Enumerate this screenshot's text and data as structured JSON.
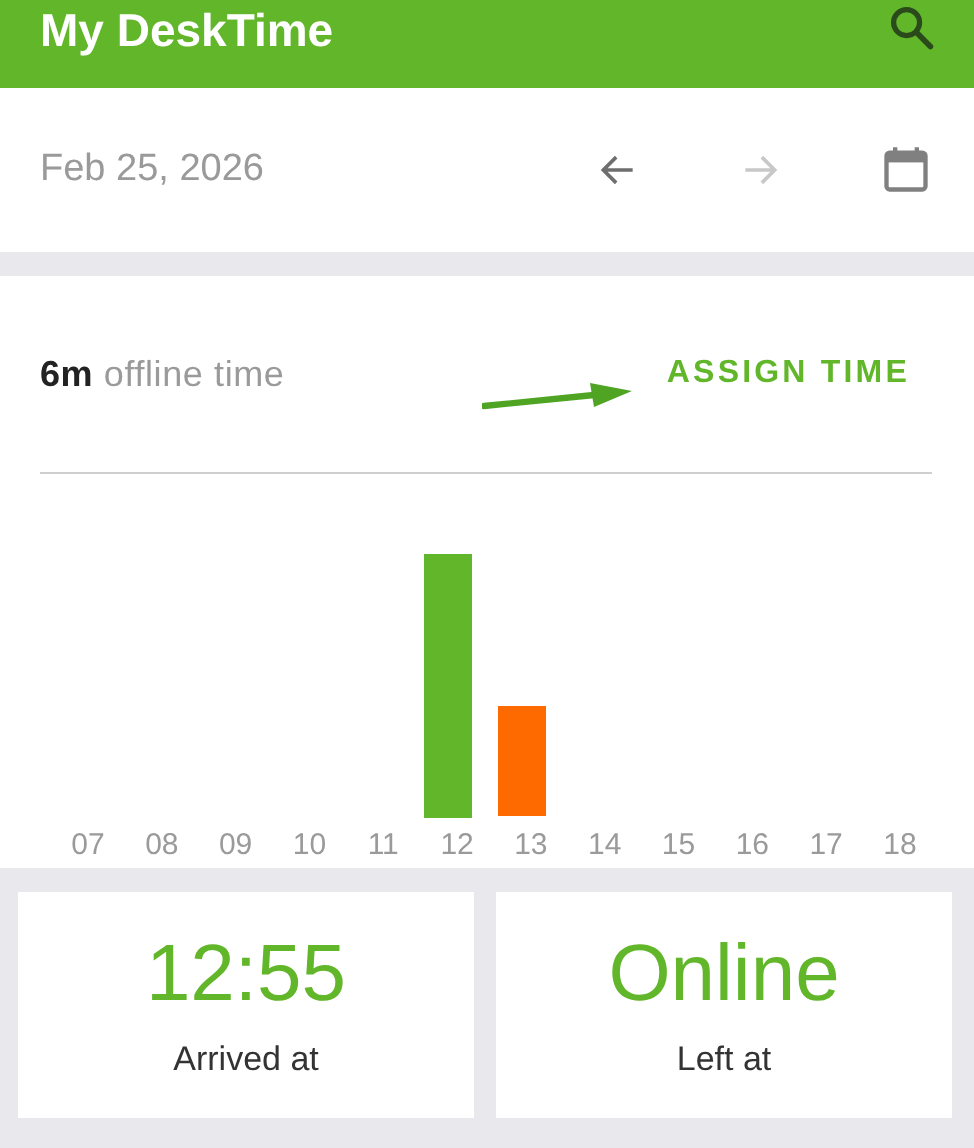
{
  "app_bar": {
    "title": "My DeskTime"
  },
  "date_bar": {
    "date": "Feb 25, 2026",
    "prev_disabled": false,
    "next_disabled": true
  },
  "offline": {
    "amount": "6m",
    "label": "offline time",
    "action": "ASSIGN TIME"
  },
  "hours": [
    {
      "label": "07"
    },
    {
      "label": "08"
    },
    {
      "label": "09"
    },
    {
      "label": "10"
    },
    {
      "label": "11"
    },
    {
      "label": "12"
    },
    {
      "label": "13"
    },
    {
      "label": "14"
    },
    {
      "label": "15"
    },
    {
      "label": "16"
    },
    {
      "label": "17"
    },
    {
      "label": "18"
    }
  ],
  "stats": [
    {
      "value": "12:55",
      "label": "Arrived at"
    },
    {
      "value": "Online",
      "label": "Left at"
    }
  ]
}
